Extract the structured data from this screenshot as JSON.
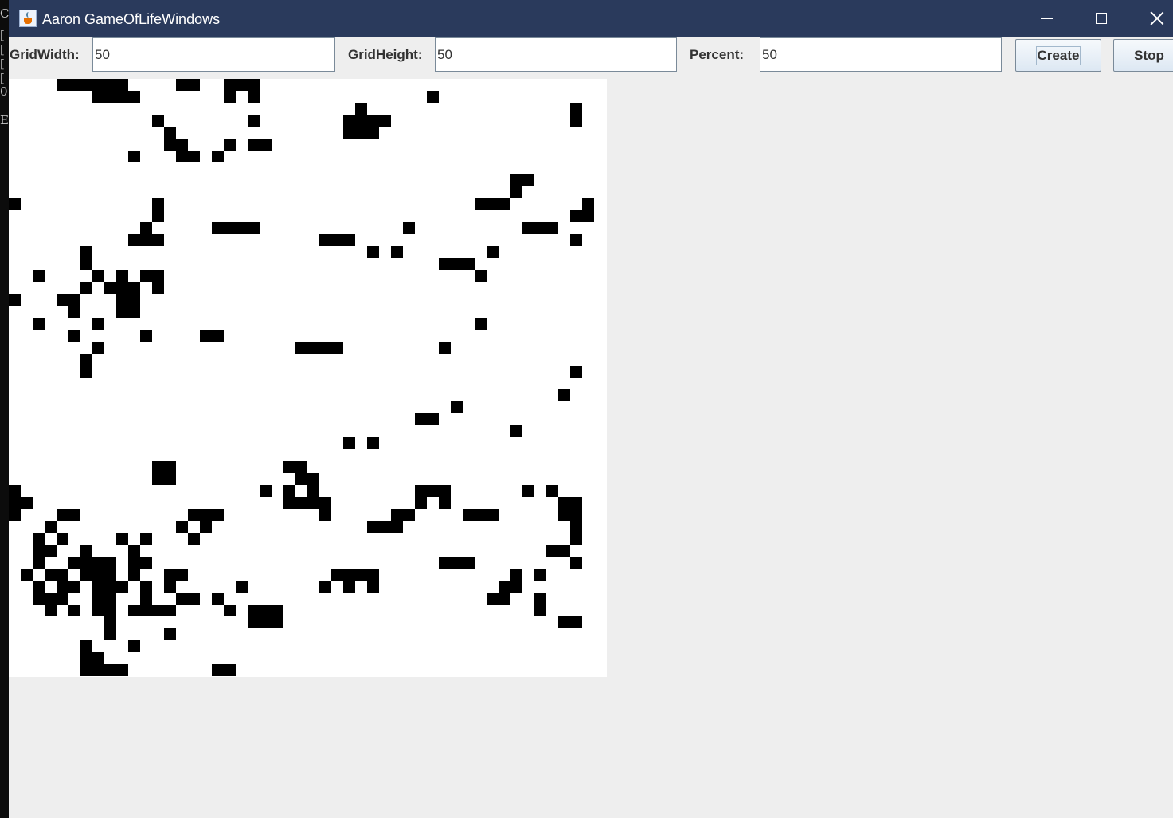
{
  "console": {
    "lines": [
      "C",
      "[",
      "[",
      "[",
      "[",
      "0",
      "E"
    ]
  },
  "window": {
    "title": "Aaron GameOfLifeWindows",
    "icon": "java-cup-icon",
    "controls": [
      "minimize-icon",
      "maximize-icon",
      "close-icon"
    ],
    "titlebar_color": "#2a3a5c"
  },
  "toolbar": {
    "grid_width_label": "GridWidth:",
    "grid_width_value": "50",
    "grid_height_label": "GridHeight:",
    "grid_height_value": "50",
    "percent_label": "Percent:",
    "percent_value": "50",
    "create_label": "Create",
    "stop_label": "Stop"
  },
  "grid": {
    "columns": 50,
    "rows": 50,
    "alive_color": "#000000",
    "dead_color": "#ffffff",
    "rows_pattern": [
      "....######....##..###............................",
      ".......####.......#.#..............#.............",
      ".............................#.................#.",
      "............#.......#.......####...............#.",
      ".............#..............###..................",
      ".............##...#.##..........................",
      "..........#...##.#..............................",
      "................................................",
      "..........................................##.....",
      "..........................................#......",
      "#...........#..........................###......#",
      "............#..................................##",
      "...........#.....####............#.........###...",
      "..........###.............###..................#.",
      "......#.......................#.#.......#.......",
      "......#.............................###.........",
      "..#....#.#.##..........................#.......",
      "......#.###.#...................................",
      "#...##...##.....................................",
      ".....#...##....................................",
      "..#....#...............................#........",
      ".....#.....#....##.............................",
      ".......#................####........#..........",
      "......#.........................................",
      "......#........................................#",
      "................................................",
      "..............................................#.",
      ".....................................#...........",
      "..................................##.............",
      "..........................................#......",
      "............................#.#.................",
      "................................................",
      "............##.........##.......................",
      "............##..........##......................",
      "#....................#.#.#........###......#.#..",
      "##.....................####.......#.#.........##",
      "#...##.........###........#.....##....###.....##",
      "...#..........#.#.............###..............#",
      "..#.#....#.#...#...............................#",
      "..##..#...#..................................##.",
      "..#..####.##........................###........#",
      ".#.##.###.#..##............####...........#.#...",
      "..#.##.###.#.#.....#......#.#.#..........##.....",
      "..###..##..#..##.#......................##..#...",
      "...#.#.##.####....#.###.....................#...",
      "........#...........###.......................##",
      "........#....#..................................",
      "......#...#.....................................",
      "......##........................................",
      "......####.......##............................."
    ]
  }
}
